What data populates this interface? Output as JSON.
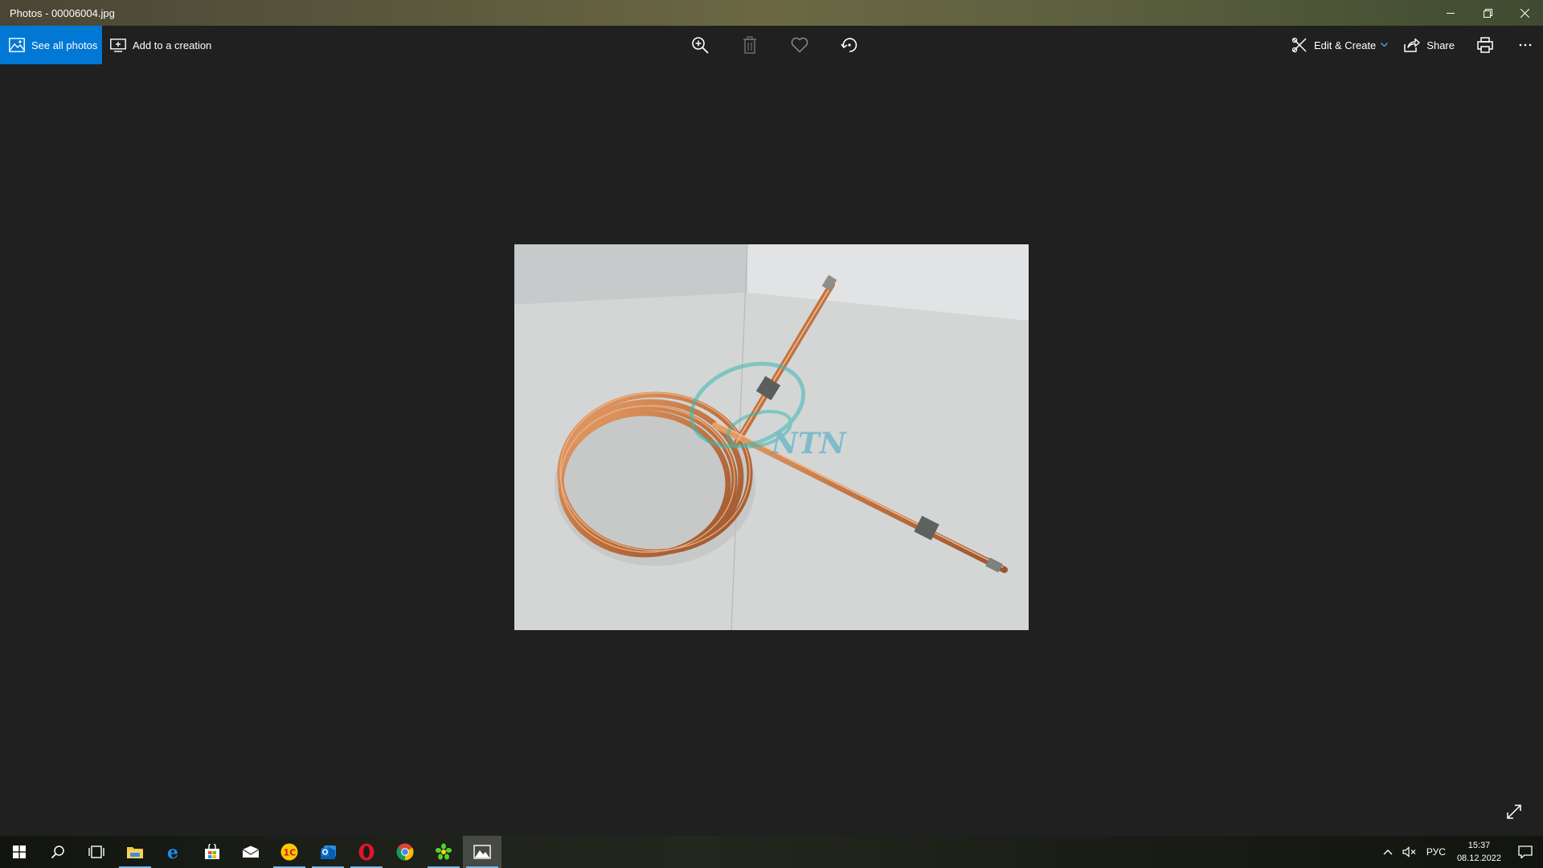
{
  "window": {
    "title": "Photos - 00006004.jpg",
    "controls": [
      "minimize-icon",
      "restore-icon",
      "close-icon"
    ]
  },
  "toolbar": {
    "see_all_label": "See all photos",
    "add_creation_label": "Add to a creation",
    "center_tools": [
      "zoom-in-icon",
      "delete-icon",
      "favorite-icon",
      "rotate-icon"
    ],
    "edit_create_label": "Edit & Create",
    "share_label": "Share",
    "print_icon": "print-icon",
    "more_icon": "more-icon"
  },
  "photo": {
    "subject": "coiled copper tube with fittings",
    "watermark_text": "NTN"
  },
  "taskbar": {
    "apps": [
      {
        "name": "start",
        "icon": "windows-logo-icon",
        "running": false
      },
      {
        "name": "search",
        "icon": "search-icon",
        "running": false
      },
      {
        "name": "task-view",
        "icon": "task-view-icon",
        "running": false
      },
      {
        "name": "file-explorer",
        "icon": "folder-icon",
        "running": true
      },
      {
        "name": "edge",
        "icon": "edge-icon",
        "running": false
      },
      {
        "name": "store",
        "icon": "store-icon",
        "running": false
      },
      {
        "name": "mail",
        "icon": "mail-icon",
        "running": false
      },
      {
        "name": "1c",
        "icon": "1c-icon",
        "running": true
      },
      {
        "name": "outlook",
        "icon": "outlook-icon",
        "running": true
      },
      {
        "name": "opera",
        "icon": "opera-icon",
        "running": true
      },
      {
        "name": "chrome",
        "icon": "chrome-icon",
        "running": false
      },
      {
        "name": "icq",
        "icon": "icq-icon",
        "running": true
      },
      {
        "name": "photos",
        "icon": "photos-icon",
        "running": true,
        "active": true
      }
    ],
    "tray": {
      "language": "РУС",
      "time": "15:37",
      "date": "08.12.2022"
    }
  },
  "colors": {
    "accent": "#0078d4",
    "background": "#202020",
    "running_indicator": "#76b9ed"
  }
}
